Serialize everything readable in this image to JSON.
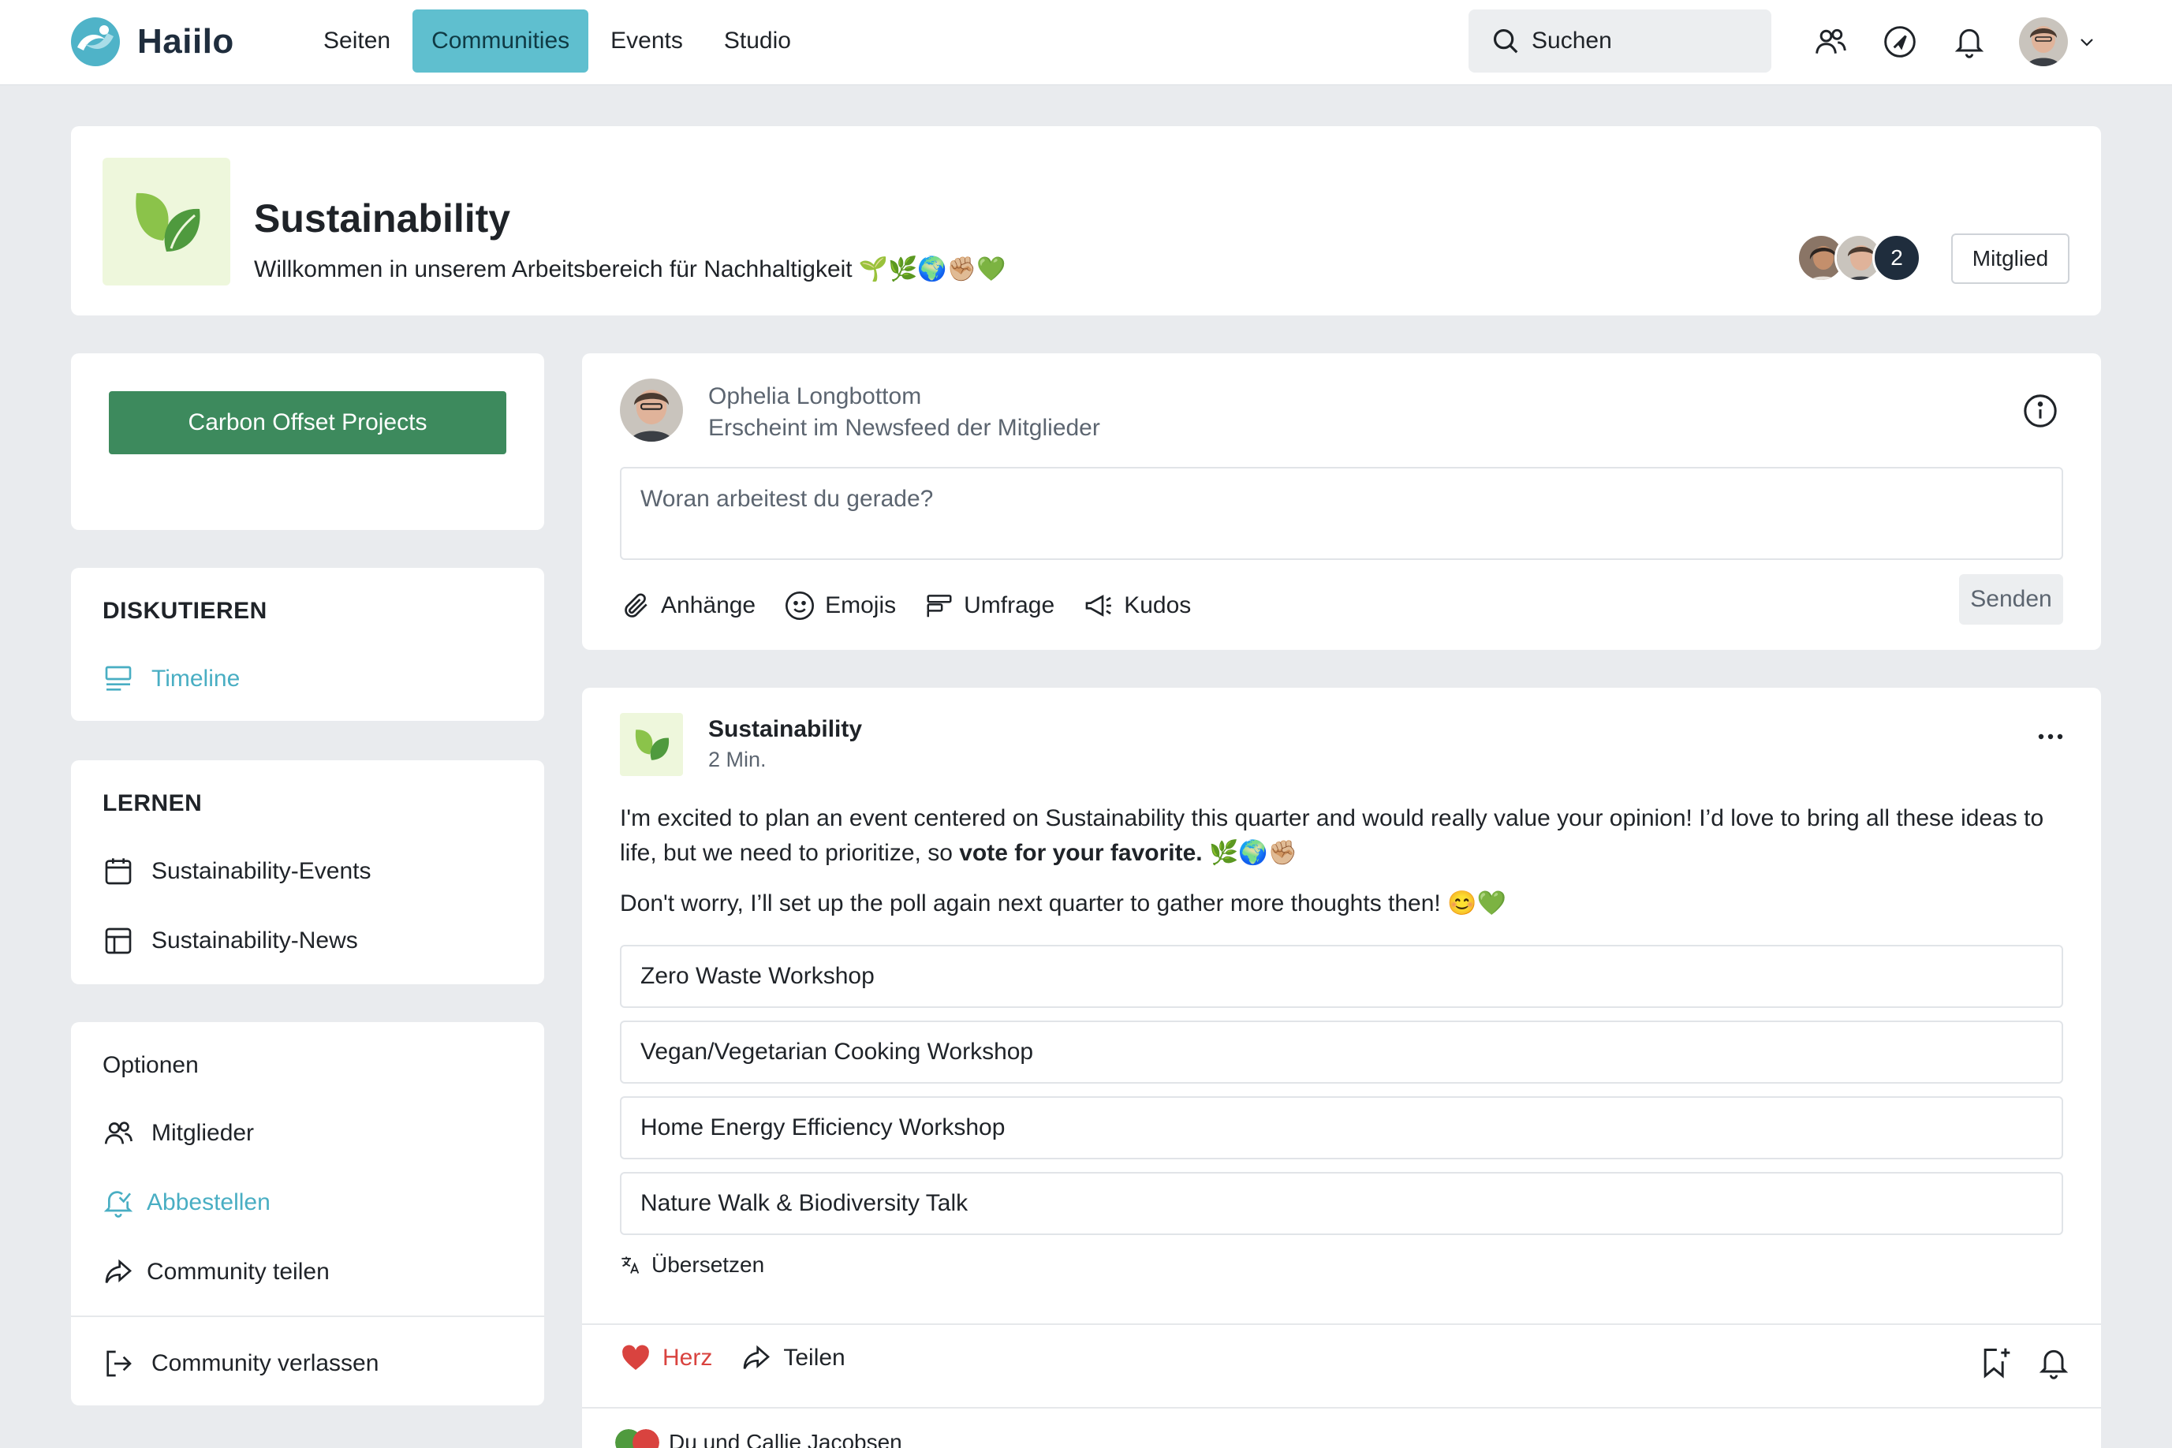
{
  "app": {
    "name": "Haiilo",
    "nav": [
      "Seiten",
      "Communities",
      "Events",
      "Studio"
    ],
    "active_nav": "Communities",
    "search_label": "Suchen",
    "brand_color": "#5fbfcf"
  },
  "community": {
    "title": "Sustainability",
    "description": "Willkommen in unserem Arbeitsbereich für Nachhaltigkeit",
    "description_emojis": "🌱🌿🌍✊🏼💚",
    "member_count": "2",
    "member_button": "Mitglied"
  },
  "sidebar": {
    "carbon_button": "Carbon Offset Projects",
    "discuss_title": "DISKUTIEREN",
    "timeline": "Timeline",
    "learn_title": "LERNEN",
    "events": "Sustainability-Events",
    "news": "Sustainability-News",
    "options_title": "Optionen",
    "members": "Mitglieder",
    "unsubscribe": "Abbestellen",
    "share": "Community teilen",
    "leave": "Community verlassen"
  },
  "composer": {
    "author": "Ophelia Longbottom",
    "subtitle": "Erscheint im Newsfeed der Mitglieder",
    "placeholder": "Woran arbeitest du gerade?",
    "tools": {
      "attachments": "Anhänge",
      "emojis": "Emojis",
      "poll": "Umfrage",
      "kudos": "Kudos"
    },
    "send": "Senden"
  },
  "post": {
    "author": "Sustainability",
    "time": "2 Min.",
    "text_1a": "I'm excited to plan an event centered on Sustainability this quarter and would really value your opinion! I’d love to bring all these ideas to life, but we need to prioritize, so ",
    "text_1b": "vote for your favorite.",
    "text_1c": " 🌿🌍✊🏼",
    "text_2": "Don't worry, I’ll set up the poll again next quarter to gather more thoughts then! 😊💚",
    "poll_options": [
      "Zero Waste Workshop",
      "Vegan/Vegetarian Cooking Workshop",
      "Home Energy Efficiency Workshop",
      "Nature Walk & Biodiversity Talk"
    ],
    "translate": "Übersetzen",
    "heart": "Herz",
    "share": "Teilen",
    "likers": "Du und Callie Jacobsen"
  }
}
